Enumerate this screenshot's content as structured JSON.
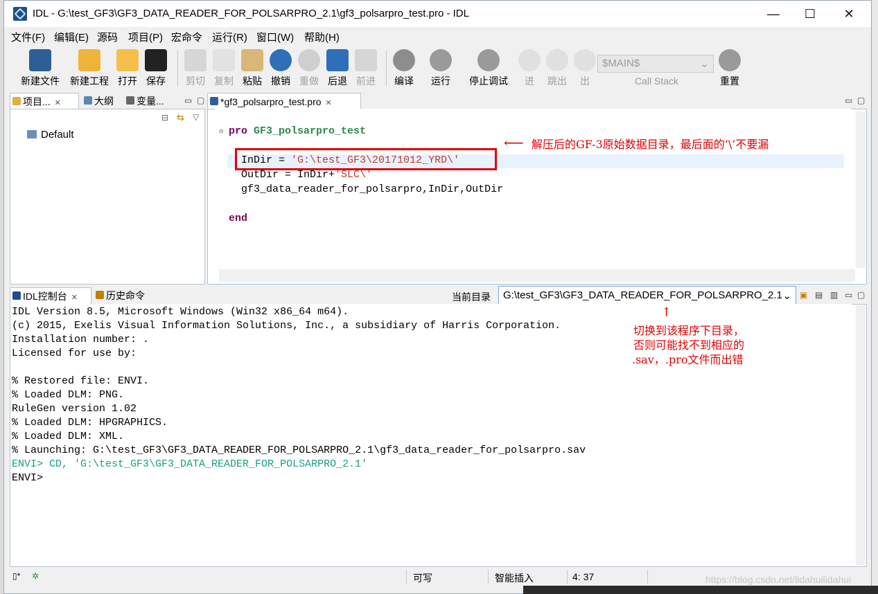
{
  "window": {
    "title": "IDL  -  G:\\test_GF3\\GF3_DATA_READER_FOR_POLSARPRO_2.1\\gf3_polsarpro_test.pro  -  IDL",
    "minimize": "—",
    "maximize": "☐",
    "close": "✕"
  },
  "menu": [
    "文件(F)",
    "编辑(E)",
    "源码",
    "项目(P)",
    "宏命令",
    "运行(R)",
    "窗口(W)",
    "帮助(H)"
  ],
  "toolbar": {
    "new_file": "新建文件",
    "new_project": "新建工程",
    "open": "打开",
    "save": "保存",
    "cut": "剪切",
    "copy": "复制",
    "paste": "粘贴",
    "undo": "撤销",
    "redo": "重做",
    "back": "后退",
    "forward": "前进",
    "compile": "编译",
    "run": "运行",
    "stop_debug": "停止调试",
    "step_in": "进",
    "step_over": "跳出",
    "step_out": "出",
    "scope_value": "$MAIN$",
    "call_stack": "Call Stack",
    "reset": "重置"
  },
  "left_panel": {
    "tabs": [
      "项目...",
      "大纲",
      "变量..."
    ],
    "tree_item": "Default"
  },
  "editor": {
    "tab": "*gf3_polsarpro_test.pro",
    "lines": {
      "l1_kw": "pro",
      "l1_name": "GF3_polsarpro_test",
      "l3_pre": "InDir = ",
      "l3_str": "'G:\\test_GF3\\20171012_YRD\\'",
      "l4_pre": "OutDir = InDir+",
      "l4_str": "'SLC\\'",
      "l5": "gf3_data_reader_for_polsarpro,InDir,OutDir",
      "l7": "end"
    },
    "annotation": "解压后的GF-3原始数据目录，最后面的‘\\’不要漏"
  },
  "console": {
    "tabs": [
      "IDL控制台",
      "历史命令"
    ],
    "current_dir_label": "当前目录",
    "current_dir": "G:\\test_GF3\\GF3_DATA_READER_FOR_POLSARPRO_2.1",
    "lines": [
      "IDL Version 8.5, Microsoft Windows (Win32 x86_64 m64).",
      "(c) 2015, Exelis Visual Information Solutions, Inc., a subsidiary of Harris Corporation.",
      "Installation number: .",
      "Licensed for use by:",
      "",
      "% Restored file: ENVI.",
      "% Loaded DLM: PNG.",
      "RuleGen version 1.02",
      "% Loaded DLM: HPGRAPHICS.",
      "% Loaded DLM: XML.",
      "% Launching: G:\\test_GF3\\GF3_DATA_READER_FOR_POLSARPRO_2.1\\gf3_data_reader_for_polsarpro.sav",
      "ENVI> CD, 'G:\\test_GF3\\GF3_DATA_READER_FOR_POLSARPRO_2.1'",
      "ENVI>"
    ],
    "annotation": [
      "切换到该程序下目录，",
      "否则可能找不到相应的",
      ".sav，.pro文件而出错"
    ]
  },
  "status": {
    "writable": "可写",
    "insert_mode": "智能插入",
    "position": "4: 37",
    "watermark": "https://blog.csdn.net/lidahuilidahui"
  },
  "colors": {
    "keyword": "#7f0055",
    "string": "#c0392b",
    "annotation": "#e00000",
    "console_cmd": "#16a085"
  }
}
